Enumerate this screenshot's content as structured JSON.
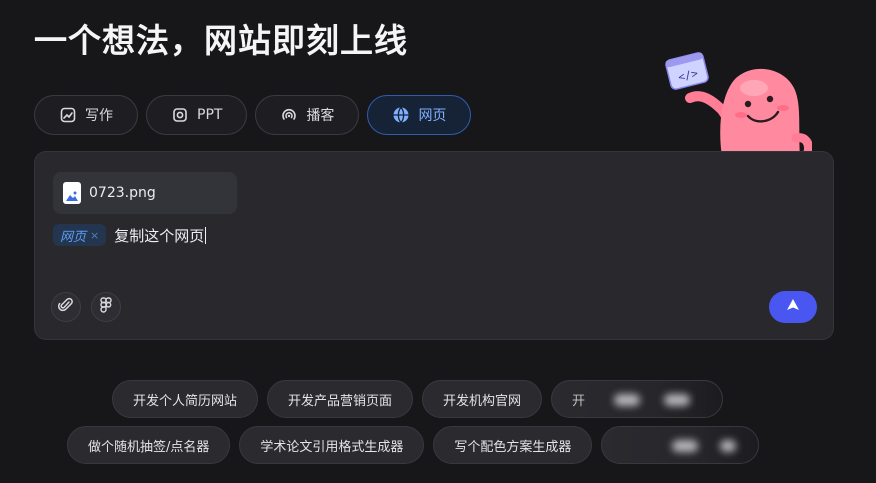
{
  "title": "一个想法，网站即刻上线",
  "tabs": [
    {
      "label": "写作",
      "icon": "edit-image-icon"
    },
    {
      "label": "PPT",
      "icon": "slides-icon"
    },
    {
      "label": "播客",
      "icon": "podcast-icon"
    },
    {
      "label": "网页",
      "icon": "globe-icon",
      "active": true
    }
  ],
  "composer": {
    "attachment": {
      "name": "0723.png",
      "icon": "image-file-icon"
    },
    "mode_tag": "网页",
    "prompt": "复制这个网页",
    "tools": [
      "paperclip-icon",
      "figma-icon"
    ],
    "send_icon": "arrow-up-icon"
  },
  "suggestions": {
    "row1": [
      "开发个人简历网站",
      "开发产品营销页面",
      "开发机构官网",
      "开"
    ],
    "row2": [
      "做个随机抽签/点名器",
      "学术论文引用格式生成器",
      "写个配色方案生成器"
    ]
  },
  "colors": {
    "accent": "#4a56f0",
    "active_tab_text": "#7fb0ff",
    "tag_text": "#5d9bf2"
  }
}
